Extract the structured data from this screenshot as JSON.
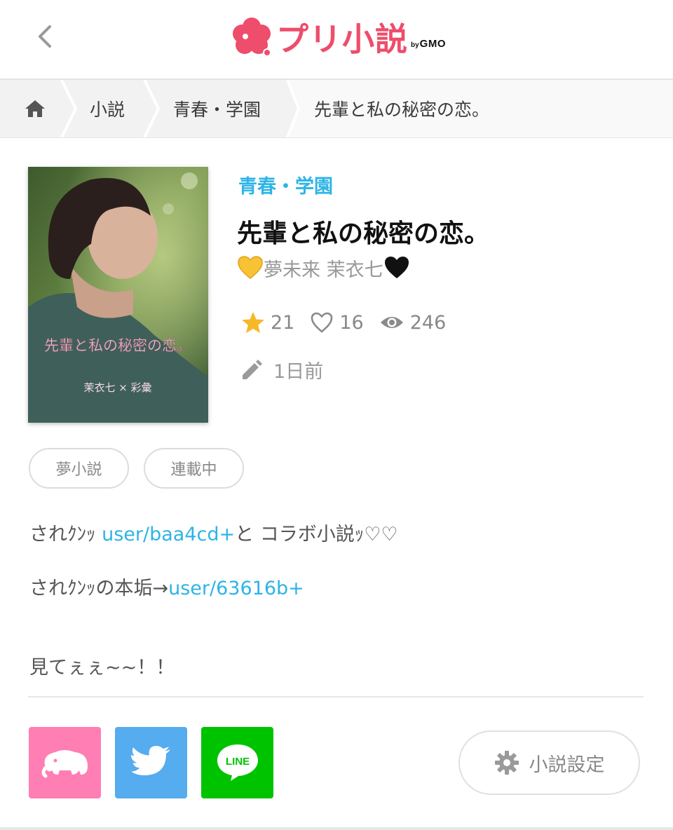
{
  "header": {
    "logo_text": "プリ小説",
    "logo_by": "by",
    "logo_gmo": "GMO"
  },
  "breadcrumb": {
    "items": [
      "小説",
      "青春・学園",
      "先輩と私の秘密の恋。"
    ]
  },
  "novel": {
    "genre": "青春・学園",
    "title": "先輩と私の秘密の恋。",
    "author_name": "夢未来 茉衣七",
    "author_emoji_left": "yellow-heart",
    "author_emoji_right": "black-heart",
    "stars": "21",
    "likes": "16",
    "views": "246",
    "updated": "1日前",
    "cover": {
      "title_text": "先輩と私の秘密の恋。",
      "credit_text": "茉衣七 × 彩彙"
    }
  },
  "tags": [
    "夢小説",
    "連載中"
  ],
  "description": {
    "line1_prefix": "されｸﾝｯ ",
    "line1_link": "user/baa4cd+",
    "line1_suffix": "と コラボ小説ｯ♡♡",
    "line2_prefix": "されｸﾝｯの本垢→",
    "line2_link": "user/63616b+",
    "line3": "見てぇぇ~~！！"
  },
  "actions": {
    "settings_label": "小説設定"
  },
  "colors": {
    "brand": "#ee4d6b",
    "link": "#2db4e6",
    "share_pink": "#ff7eb3",
    "share_twitter": "#55acee",
    "share_line": "#00c300",
    "star": "#f6b829"
  }
}
